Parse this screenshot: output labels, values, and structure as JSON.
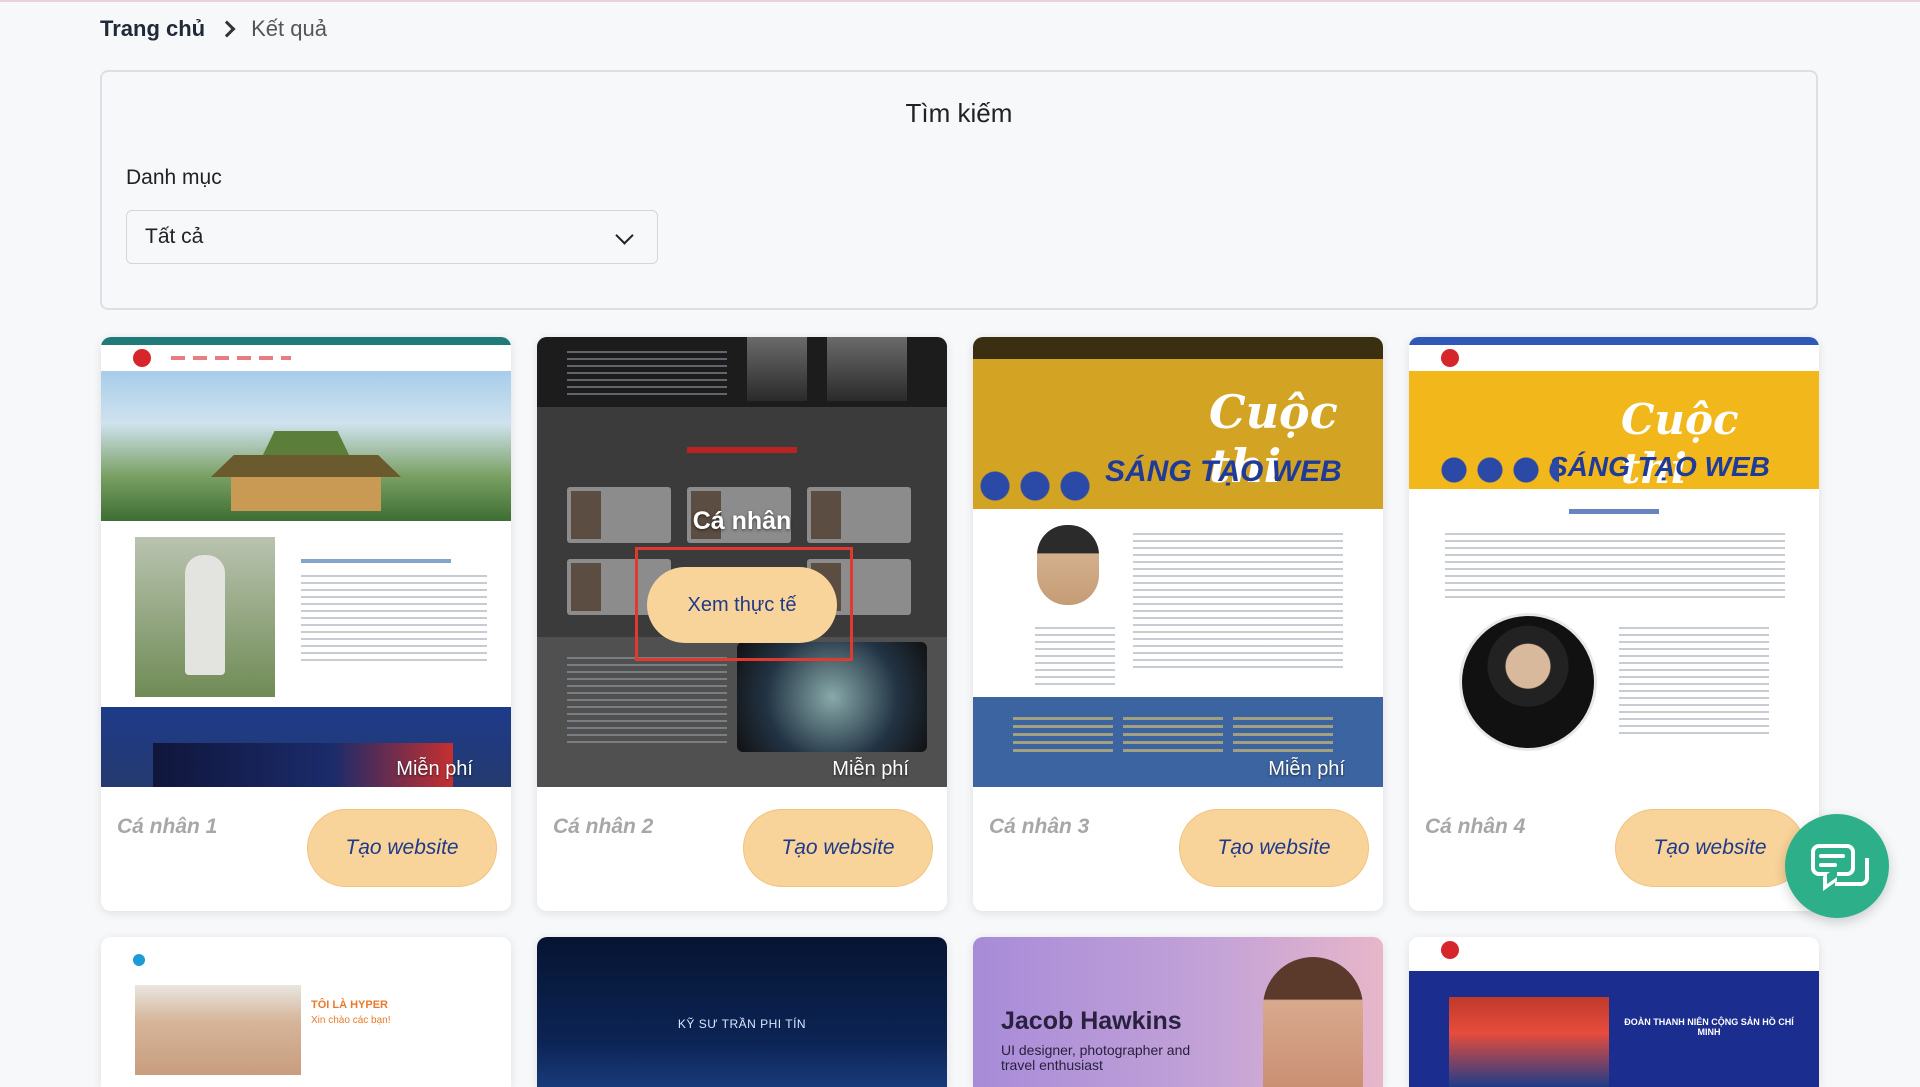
{
  "breadcrumb": {
    "home": "Trang chủ",
    "current": "Kết quả"
  },
  "search": {
    "title": "Tìm kiếm",
    "category_label": "Danh mục",
    "category_value": "Tất cả"
  },
  "cards": [
    {
      "name": "Cá nhân 1",
      "price": "Miễn phí",
      "button": "Tạo website"
    },
    {
      "name": "Cá nhân 2",
      "price": "Miễn phí",
      "button": "Tạo website",
      "overlay_title": "Cá nhân",
      "overlay_button": "Xem thực tế"
    },
    {
      "name": "Cá nhân 3",
      "price": "Miễn phí",
      "button": "Tạo website",
      "hero_title": "Cuộc thi",
      "hero_sub": "SÁNG TẠO WEB"
    },
    {
      "name": "Cá nhân 4",
      "price": "Miễn phí",
      "button": "Tạo website",
      "hero_title": "Cuộc thi",
      "hero_sub": "SÁNG TẠO WEB"
    }
  ],
  "row2": {
    "card1": {
      "title": "TÔI LÀ HYPER",
      "subtitle": "Xin chào các bạn!"
    },
    "card2": {
      "title": "KỸ SƯ TRẦN PHI TÍN"
    },
    "card3": {
      "name": "Jacob Hawkins",
      "desc": "UI designer, photographer and travel enthusiast"
    },
    "card4": {
      "title": "ĐOÀN THANH NIÊN CỘNG SẢN HỒ CHÍ MINH"
    }
  },
  "colors": {
    "accent_button": "#f8d39a",
    "button_text": "#1e3a8a",
    "chat_fab": "#2db08a",
    "highlight_border": "#e03a2f"
  },
  "icons": {
    "breadcrumb_separator": "chevron-right-icon",
    "select_arrow": "chevron-down-icon",
    "chat": "chat-bubbles-icon"
  }
}
